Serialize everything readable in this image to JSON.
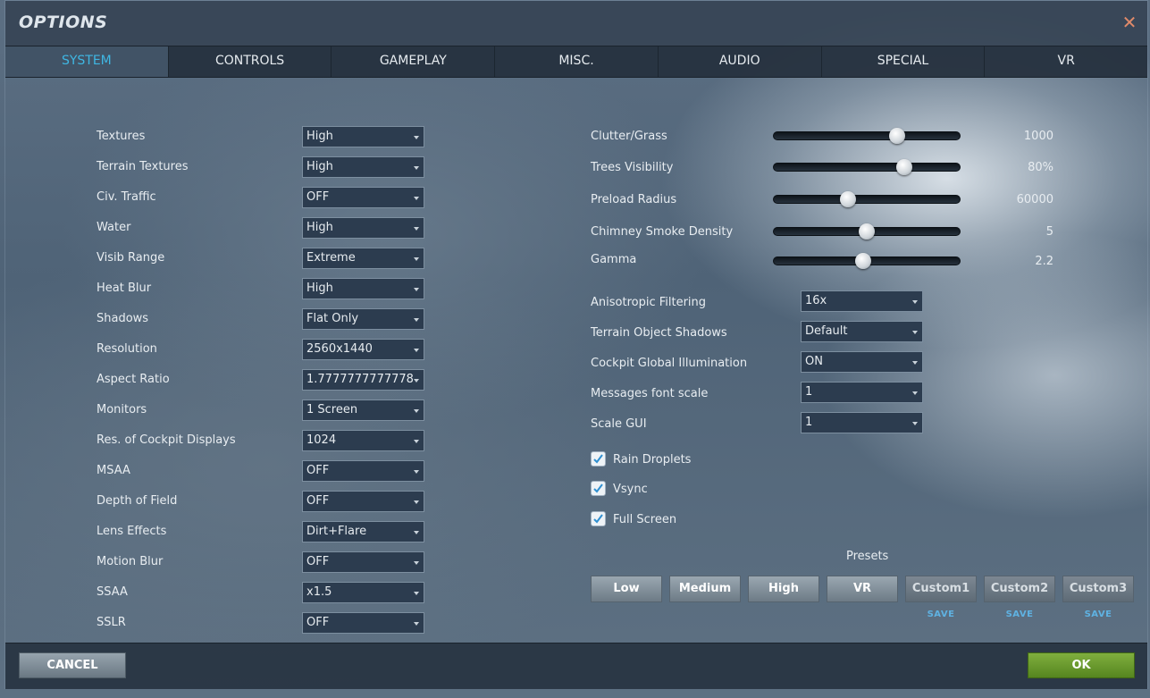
{
  "window": {
    "title": "OPTIONS",
    "close_icon": "close-icon"
  },
  "tabs": [
    "SYSTEM",
    "CONTROLS",
    "GAMEPLAY",
    "MISC.",
    "AUDIO",
    "SPECIAL",
    "VR"
  ],
  "active_tab": "SYSTEM",
  "left_settings": [
    {
      "label": "Textures",
      "value": "High"
    },
    {
      "label": "Terrain Textures",
      "value": "High"
    },
    {
      "label": "Civ. Traffic",
      "value": "OFF"
    },
    {
      "label": "Water",
      "value": "High"
    },
    {
      "label": "Visib Range",
      "value": "Extreme"
    },
    {
      "label": "Heat Blur",
      "value": "High"
    },
    {
      "label": "Shadows",
      "value": "Flat Only"
    },
    {
      "label": "Resolution",
      "value": "2560x1440"
    },
    {
      "label": "Aspect Ratio",
      "value": "1.7777777777778"
    },
    {
      "label": "Monitors",
      "value": "1 Screen"
    },
    {
      "label": "Res. of Cockpit Displays",
      "value": "1024"
    },
    {
      "label": "MSAA",
      "value": "OFF"
    },
    {
      "label": "Depth of Field",
      "value": "OFF"
    },
    {
      "label": "Lens Effects",
      "value": "Dirt+Flare"
    },
    {
      "label": "Motion Blur",
      "value": "OFF"
    },
    {
      "label": "SSAA",
      "value": "x1.5"
    },
    {
      "label": "SSLR",
      "value": "OFF"
    }
  ],
  "sliders": [
    {
      "label": "Clutter/Grass",
      "value": "1000",
      "level": 0.66
    },
    {
      "label": "Trees Visibility",
      "value": "80%",
      "level": 0.7
    },
    {
      "label": "Preload Radius",
      "value": "60000",
      "level": 0.4
    },
    {
      "label": "Chimney Smoke Density",
      "value": "5",
      "level": 0.5
    },
    {
      "label": "Gamma",
      "value": "2.2",
      "level": 0.48
    }
  ],
  "right_settings": [
    {
      "label": "Anisotropic Filtering",
      "value": "16x"
    },
    {
      "label": "Terrain Object Shadows",
      "value": "Default"
    },
    {
      "label": "Cockpit Global Illumination",
      "value": "ON"
    },
    {
      "label": "Messages font scale",
      "value": "1"
    },
    {
      "label": "Scale GUI",
      "value": "1"
    }
  ],
  "checkboxes": [
    {
      "label": "Rain Droplets",
      "checked": true
    },
    {
      "label": "Vsync",
      "checked": true
    },
    {
      "label": "Full Screen",
      "checked": true
    }
  ],
  "presets": {
    "title": "Presets",
    "buttons": [
      "Low",
      "Medium",
      "High",
      "VR",
      "Custom1",
      "Custom2",
      "Custom3"
    ],
    "save_label": "SAVE"
  },
  "footer": {
    "cancel_label": "CANCEL",
    "ok_label": "OK"
  },
  "colors": {
    "accent_tab": "#3fb7e3",
    "ok_green": "#6a9a2e",
    "save_blue": "#5fb2e2"
  }
}
